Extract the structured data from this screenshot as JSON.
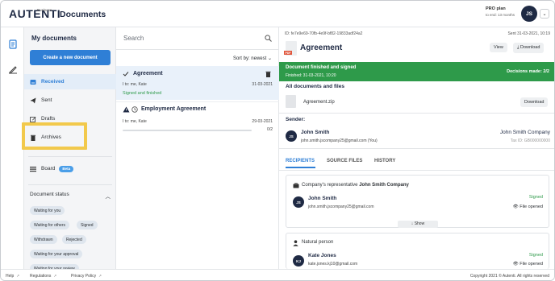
{
  "header": {
    "logo": "AUTENTI",
    "logo_sub": "Business",
    "title": "Documents",
    "plan": "PRO plan",
    "plan_sub": "to end: 13 months",
    "user_initials": "JS"
  },
  "nav": {
    "title": "My documents",
    "create_label": "Create a new document",
    "items": [
      {
        "label": "Received"
      },
      {
        "label": "Sent"
      },
      {
        "label": "Drafts"
      },
      {
        "label": "Archives"
      }
    ],
    "board_label": "Board",
    "board_badge": "Beta",
    "status_title": "Document status",
    "chips": [
      "Waiting for you",
      "Waiting for others",
      "Signed",
      "Withdrawn",
      "Rejected",
      "Waiting for your approval",
      "Waiting for your review"
    ]
  },
  "list": {
    "search_placeholder": "Search",
    "sort_label": "Sort by: newest",
    "rows": [
      {
        "title": "Agreement",
        "meta": "I to: me, Kate",
        "date": "31-03-2021",
        "status": "Signed and finished"
      },
      {
        "title": "Employment Agreement",
        "meta": "I to: me, Kate",
        "date": "29-03-2021",
        "progress_text": "0/2",
        "progress": 0.0
      }
    ]
  },
  "detail": {
    "id": "ID: fe7e9e69-70fb-4e9f-bf82-19833adf24a2",
    "sent": "Sent 31-03-2021, 10:19",
    "pdf_tag": "PDF",
    "title": "Agreement",
    "view_label": "View",
    "download_label": "Download",
    "banner_title": "Document finished and signed",
    "banner_sub": "Finished: 31-03-2021, 10:20",
    "decisions": "Decisions made: 2/2",
    "files_title": "All documents and files",
    "zip_name": "Agreement.zip",
    "zip_download": "Download",
    "sender_label": "Sender:",
    "sender_name": "John Smith",
    "sender_email": "john.smith.jscompany25@gmail.com (You)",
    "sender_company": "John Smith Company",
    "tax_id": "Tax ID: GB000000000",
    "tabs": [
      "RECIPIENTS",
      "SOURCE FILES",
      "HISTORY"
    ],
    "rep_prefix": "Company's representative",
    "rep_company": "John Smith Company",
    "rep_name": "John Smith",
    "rep_email": "john.smith.jscompany25@gmail.com",
    "rep_status": "Signed",
    "rep_file": "File opened",
    "show_label": "Show",
    "np_label": "Natural person",
    "np_name": "Kate Jones",
    "np_email": "kate.jones.kj10@gmail.com",
    "np_initials": "KJ",
    "np_status": "Signed",
    "np_file": "File opened"
  },
  "footer": {
    "links": [
      "Help",
      "Regulations",
      "Privacy Policy"
    ],
    "copyright": "Copyright 2021 © Autenti. All rights reserved"
  },
  "colors": {
    "accent": "#2f7fd6",
    "success": "#2e9a4a",
    "highlight": "#f2c94c"
  }
}
